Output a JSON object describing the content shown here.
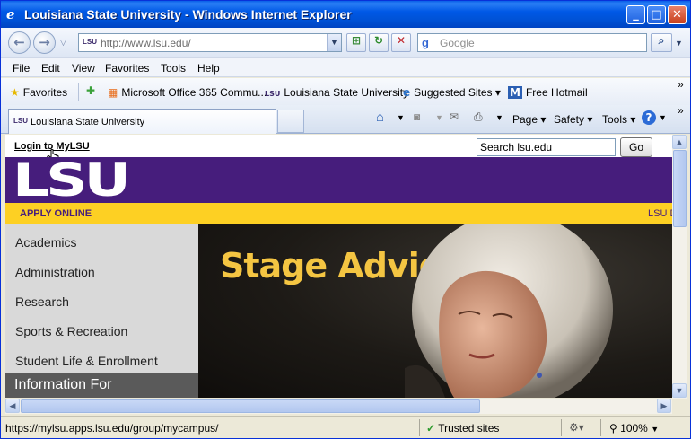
{
  "window": {
    "title": "Louisiana State University - Windows Internet Explorer",
    "minimize": "_",
    "maximize": "□",
    "close": "✕"
  },
  "nav": {
    "back": "←",
    "forward": "→",
    "address_icon": "LSU",
    "url": "http://www.lsu.edu/",
    "search_placeholder": "Google",
    "refresh": "↻",
    "stop": "✕",
    "search_go": "⌕"
  },
  "menu": [
    "File",
    "Edit",
    "View",
    "Favorites",
    "Tools",
    "Help"
  ],
  "favorites_bar": {
    "favorites_label": "Favorites",
    "items": [
      "Microsoft Office 365 Commu...",
      "Louisiana State University",
      "Suggested Sites ▾",
      "Free Hotmail"
    ],
    "overflow": "»"
  },
  "tabs": {
    "active_label": "Louisiana State University",
    "icon_text": "LSU"
  },
  "command_bar": {
    "page": "Page ▾",
    "safety": "Safety ▾",
    "tools": "Tools ▾",
    "help": "?",
    "overflow": "»"
  },
  "page": {
    "login_link": "Login to MyLSU",
    "search_value": "Search lsu.edu",
    "go_button": "Go",
    "logo_text": "LSU",
    "apply_online": "APPLY ONLINE",
    "gold_right": "LSU D",
    "left_nav": [
      "Academics",
      "Administration",
      "Research",
      "Sports & Recreation",
      "Student Life & Enrollment"
    ],
    "info_for": "Information For",
    "hero_title": "Stage Advice"
  },
  "status": {
    "url": "https://mylsu.apps.lsu.edu/group/mycampus/",
    "zone": "Trusted sites",
    "zoom": "100%"
  },
  "colors": {
    "lsu_purple": "#461d7c",
    "lsu_gold": "#fdd023",
    "hero_title": "#f4c542",
    "titlebar_blue": "#0058e6"
  }
}
